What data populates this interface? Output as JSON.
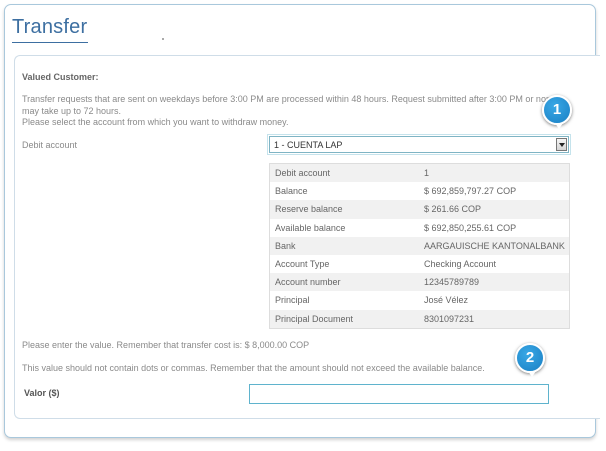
{
  "title": "Transfer",
  "greeting": "Valued Customer:",
  "intro_lines": [
    "Transfer requests that are sent on weekdays before 3:00 PM are processed within 48 hours. Request submitted after 3:00 PM or non-w",
    "may take up to 72 hours.",
    "Please select the account from which you want to withdraw money."
  ],
  "debit_label": "Debit account",
  "debit_select_value": "1 - CUENTA LAP",
  "details": [
    {
      "label": "Debit account",
      "value": "1"
    },
    {
      "label": "Balance",
      "value": "$ 692,859,797.27 COP"
    },
    {
      "label": "Reserve balance",
      "value": "$ 261.66 COP"
    },
    {
      "label": "Available balance",
      "value": "$ 692,850,255.61 COP"
    },
    {
      "label": "Bank",
      "value": "AARGAUISCHE KANTONALBANK"
    },
    {
      "label": "Account Type",
      "value": "Checking Account"
    },
    {
      "label": "Account number",
      "value": "12345789789"
    },
    {
      "label": "Principal",
      "value": "José Vélez"
    },
    {
      "label": "Principal Document",
      "value": "8301097231"
    }
  ],
  "cost_note": "Please enter the value. Remember that transfer cost is: $ 8,000.00 COP",
  "format_note": "This value should not contain dots or commas. Remember that the amount should not exceed the available balance.",
  "valor_label": "Valor ($)",
  "valor_value": "",
  "badges": [
    "1",
    "2"
  ]
}
